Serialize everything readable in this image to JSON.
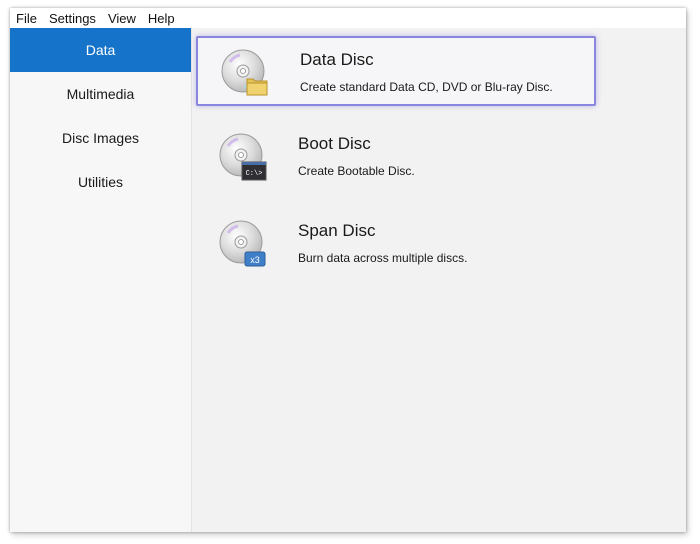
{
  "menubar": {
    "items": [
      "File",
      "Settings",
      "View",
      "Help"
    ]
  },
  "sidebar": {
    "items": [
      {
        "label": "Data",
        "active": true
      },
      {
        "label": "Multimedia",
        "active": false
      },
      {
        "label": "Disc Images",
        "active": false
      },
      {
        "label": "Utilities",
        "active": false
      }
    ]
  },
  "options": [
    {
      "title": "Data Disc",
      "description": "Create standard Data CD, DVD or Blu-ray Disc.",
      "icon": "disc-folder-icon",
      "selected": true
    },
    {
      "title": "Boot Disc",
      "description": "Create Bootable Disc.",
      "icon": "disc-terminal-icon",
      "badge": "C:\\>",
      "selected": false
    },
    {
      "title": "Span Disc",
      "description": "Burn data across multiple discs.",
      "icon": "disc-multi-icon",
      "badge": "x3",
      "selected": false
    }
  ],
  "colors": {
    "accent": "#1573c9",
    "selection_border": "#8a86e0",
    "badge_blue": "#3f7fc8"
  }
}
